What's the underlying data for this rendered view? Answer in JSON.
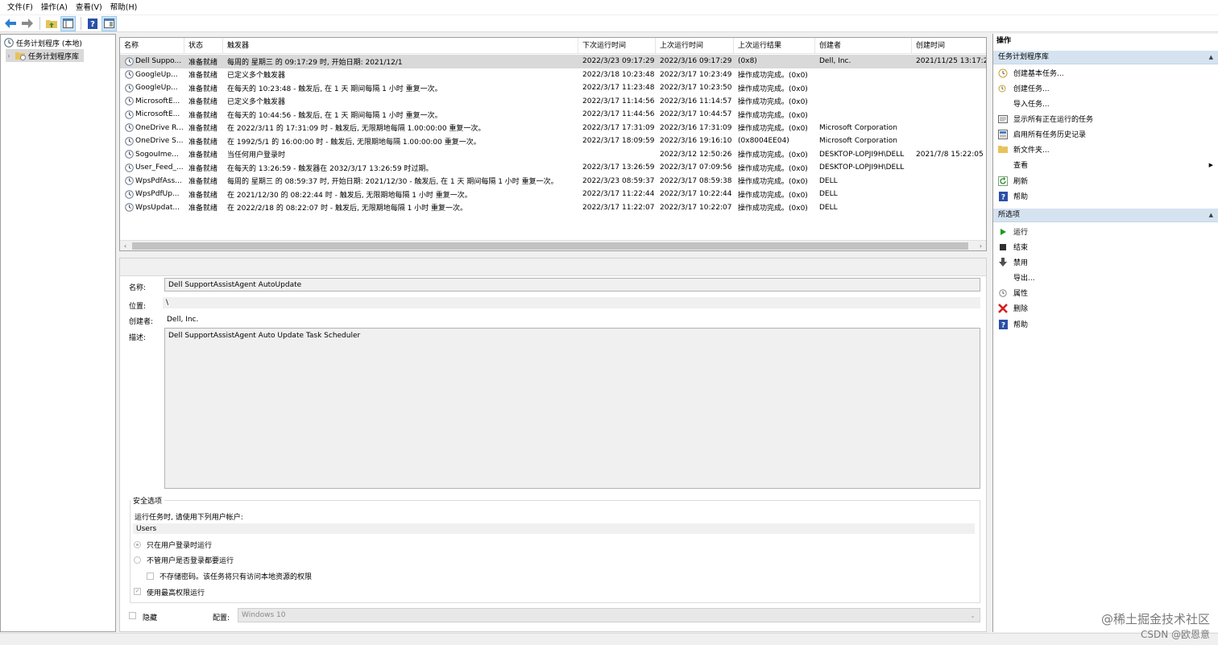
{
  "menu": [
    "文件(F)",
    "操作(A)",
    "查看(V)",
    "帮助(H)"
  ],
  "tree": {
    "root": "任务计划程序 (本地)",
    "library": "任务计划程序库"
  },
  "table": {
    "columns": [
      "名称",
      "状态",
      "触发器",
      "下次运行时间",
      "上次运行时间",
      "上次运行结果",
      "创建者",
      "创建时间"
    ],
    "rows": [
      [
        "Dell Suppo...",
        "准备就绪",
        "每周的 星期三 的 09:17:29 时, 开始日期: 2021/12/1",
        "2022/3/23 09:17:29",
        "2022/3/16 09:17:29",
        "(0x8)",
        "Dell, Inc.",
        "2021/11/25 13:17:2"
      ],
      [
        "GoogleUp...",
        "准备就绪",
        "已定义多个触发器",
        "2022/3/18 10:23:48",
        "2022/3/17 10:23:49",
        "操作成功完成。(0x0)",
        "",
        ""
      ],
      [
        "GoogleUp...",
        "准备就绪",
        "在每天的 10:23:48 - 触发后, 在 1 天 期间每隔 1 小时 重复一次。",
        "2022/3/17 11:23:48",
        "2022/3/17 10:23:50",
        "操作成功完成。(0x0)",
        "",
        ""
      ],
      [
        "MicrosoftE...",
        "准备就绪",
        "已定义多个触发器",
        "2022/3/17 11:14:56",
        "2022/3/16 11:14:57",
        "操作成功完成。(0x0)",
        "",
        ""
      ],
      [
        "MicrosoftE...",
        "准备就绪",
        "在每天的 10:44:56 - 触发后, 在 1 天 期间每隔 1 小时 重复一次。",
        "2022/3/17 11:44:56",
        "2022/3/17 10:44:57",
        "操作成功完成。(0x0)",
        "",
        ""
      ],
      [
        "OneDrive R...",
        "准备就绪",
        "在 2022/3/11 的 17:31:09 时 - 触发后, 无限期地每隔 1.00:00:00 重复一次。",
        "2022/3/17 17:31:09",
        "2022/3/16 17:31:09",
        "操作成功完成。(0x0)",
        "Microsoft Corporation",
        ""
      ],
      [
        "OneDrive S...",
        "准备就绪",
        "在 1992/5/1 的 16:00:00 时 - 触发后, 无限期地每隔 1.00:00:00 重复一次。",
        "2022/3/17 18:09:59",
        "2022/3/16 19:16:10",
        "(0x8004EE04)",
        "Microsoft Corporation",
        ""
      ],
      [
        "SogouIme...",
        "准备就绪",
        "当任何用户登录时",
        "",
        "2022/3/12 12:50:26",
        "操作成功完成。(0x0)",
        "DESKTOP-LOPJI9H\\DELL",
        "2021/7/8 15:22:05"
      ],
      [
        "User_Feed_...",
        "准备就绪",
        "在每天的 13:26:59 - 触发器在 2032/3/17 13:26:59 时过期。",
        "2022/3/17 13:26:59",
        "2022/3/17 07:09:56",
        "操作成功完成。(0x0)",
        "DESKTOP-LOPJI9H\\DELL",
        ""
      ],
      [
        "WpsPdfAss...",
        "准备就绪",
        "每周的 星期三 的 08:59:37 时, 开始日期: 2021/12/30 - 触发后, 在 1 天 期间每隔 1 小时 重复一次。",
        "2022/3/23 08:59:37",
        "2022/3/17 08:59:38",
        "操作成功完成。(0x0)",
        "DELL",
        ""
      ],
      [
        "WpsPdfUp...",
        "准备就绪",
        "在 2021/12/30 的 08:22:44 时 - 触发后, 无限期地每隔 1 小时 重复一次。",
        "2022/3/17 11:22:44",
        "2022/3/17 10:22:44",
        "操作成功完成。(0x0)",
        "DELL",
        ""
      ],
      [
        "WpsUpdat...",
        "准备就绪",
        "在 2022/2/18 的 08:22:07 时 - 触发后, 无限期地每隔 1 小时 重复一次。",
        "2022/3/17 11:22:07",
        "2022/3/17 10:22:07",
        "操作成功完成。(0x0)",
        "DELL",
        ""
      ]
    ]
  },
  "detail": {
    "name_label": "名称:",
    "name_value": "Dell SupportAssistAgent AutoUpdate",
    "location_label": "位置:",
    "location_value": "\\",
    "author_label": "创建者:",
    "author_value": "Dell, Inc.",
    "desc_label": "描述:",
    "desc_value": "Dell SupportAssistAgent Auto Update Task Scheduler",
    "security_title": "安全选项",
    "run_as_label": "运行任务时, 请使用下列用户帐户:",
    "run_as_value": "Users",
    "radio_logged_on": "只在用户登录时运行",
    "radio_whether": "不管用户是否登录都要运行",
    "no_store_pwd": "不存储密码。该任务将只有访问本地资源的权限",
    "highest_priv": "使用最高权限运行",
    "hidden_label": "隐藏",
    "config_label": "配置:",
    "config_value": "Windows 10"
  },
  "actions": {
    "header": "操作",
    "section1": "任务计划程序库",
    "items1": [
      "创建基本任务...",
      "创建任务...",
      "导入任务...",
      "显示所有正在运行的任务",
      "启用所有任务历史记录",
      "新文件夹...",
      "查看",
      "刷新",
      "帮助"
    ],
    "section2": "所选项",
    "items2": [
      "运行",
      "结束",
      "禁用",
      "导出...",
      "属性",
      "删除",
      "帮助"
    ]
  },
  "watermark": {
    "line1": "@稀土掘金技术社区",
    "line2": "CSDN @欧恩意"
  },
  "colors": {
    "section_bg": "#d5e3f1",
    "selected_row": "#d9d9d9",
    "run_green": "#1a9c1a",
    "delete_red": "#d42020",
    "help_blue": "#2a4fa8"
  }
}
